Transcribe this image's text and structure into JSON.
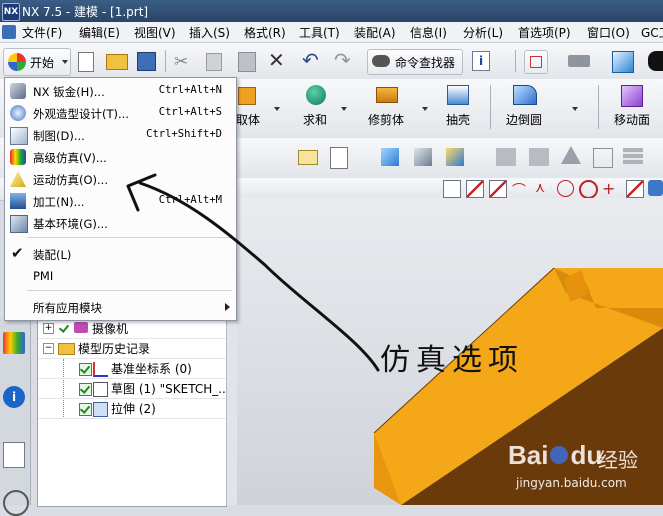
{
  "window": {
    "title": "NX 7.5 - 建模 - [1.prt]",
    "logo_text": "NX"
  },
  "menubar": [
    {
      "label": "文件(F)"
    },
    {
      "label": "编辑(E)"
    },
    {
      "label": "视图(V)"
    },
    {
      "label": "插入(S)"
    },
    {
      "label": "格式(R)"
    },
    {
      "label": "工具(T)"
    },
    {
      "label": "装配(A)"
    },
    {
      "label": "信息(I)"
    },
    {
      "label": "分析(L)"
    },
    {
      "label": "首选项(P)"
    },
    {
      "label": "窗口(O)"
    },
    {
      "label": "GC工"
    }
  ],
  "toolbar": {
    "start_label": "开始",
    "command_finder_label": "命令查找器"
  },
  "feature_toolbar": {
    "items": [
      {
        "label": "取体"
      },
      {
        "label": "求和"
      },
      {
        "label": "修剪体"
      },
      {
        "label": "抽壳"
      },
      {
        "label": "边倒圆"
      },
      {
        "label": "移动面"
      }
    ]
  },
  "start_menu": {
    "items": [
      {
        "label": "NX 钣金(H)...",
        "shortcut": "Ctrl+Alt+N",
        "icon": "sheet-metal-icon"
      },
      {
        "label": "外观造型设计(T)...",
        "shortcut": "Ctrl+Alt+S",
        "icon": "shape-studio-icon"
      },
      {
        "label": "制图(D)...",
        "shortcut": "Ctrl+Shift+D",
        "icon": "drafting-icon"
      },
      {
        "label": "高级仿真(V)...",
        "shortcut": "",
        "icon": "advanced-simulation-icon"
      },
      {
        "label": "运动仿真(O)...",
        "shortcut": "",
        "icon": "motion-simulation-icon"
      },
      {
        "label": "加工(N)...",
        "shortcut": "Ctrl+Alt+M",
        "icon": "manufacturing-icon"
      },
      {
        "label": "基本环境(G)...",
        "shortcut": "",
        "icon": "gateway-icon"
      }
    ],
    "assembly_label": "装配(L)",
    "pmi_label": "PMI",
    "all_apps_label": "所有应用模块"
  },
  "navigator": {
    "rows": [
      {
        "label": "摄像机",
        "icon": "camera-icon"
      },
      {
        "label": "模型历史记录",
        "icon": "folder-icon"
      },
      {
        "label": "基准坐标系 (0)",
        "icon": "datum-csys-icon"
      },
      {
        "label": "草图 (1) \"SKETCH_...",
        "icon": "sketch-icon"
      },
      {
        "label": "拉伸 (2)",
        "icon": "extrude-icon"
      }
    ]
  },
  "annotation": {
    "text": "仿真选项"
  },
  "watermark": {
    "brand": "Bai",
    "brand2": "du",
    "suffix": "经验",
    "url": "jingyan.baidu.com"
  },
  "colors": {
    "title_bar": "#2f4f78",
    "model_orange": "#f0a010",
    "model_shadow": "#6b3a0a"
  }
}
